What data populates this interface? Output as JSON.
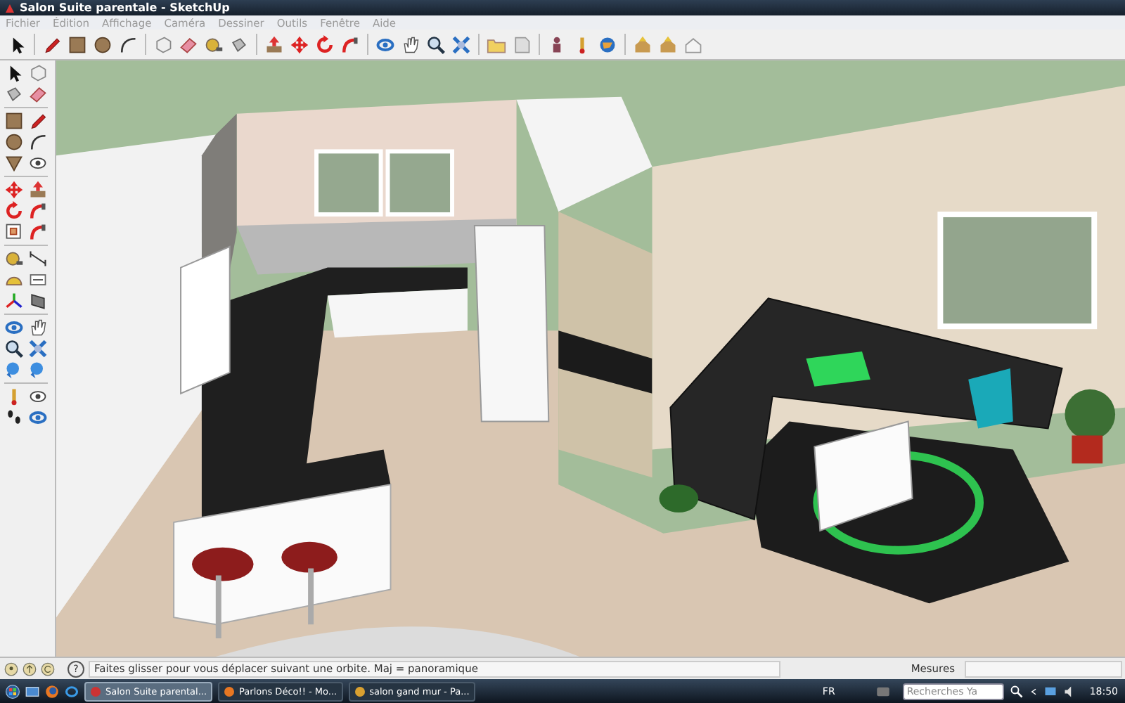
{
  "window": {
    "title": "Salon Suite parentale - SketchUp"
  },
  "menu": [
    "Fichier",
    "Édition",
    "Affichage",
    "Caméra",
    "Dessiner",
    "Outils",
    "Fenêtre",
    "Aide"
  ],
  "status_bar": {
    "help_symbol": "?",
    "hint": "Faites glisser pour vous déplacer suivant une orbite.  Maj = panoramique",
    "measurements_label": "Mesures"
  },
  "taskbar": {
    "buttons": [
      {
        "label": "Salon Suite parental...",
        "selected": true
      },
      {
        "label": "Parlons Déco!! - Mo...",
        "selected": false
      },
      {
        "label": "salon gand mur - Pa...",
        "selected": false
      }
    ],
    "language": "FR",
    "search": {
      "placeholder": "Recherches Ya"
    },
    "clock": "18:50"
  }
}
